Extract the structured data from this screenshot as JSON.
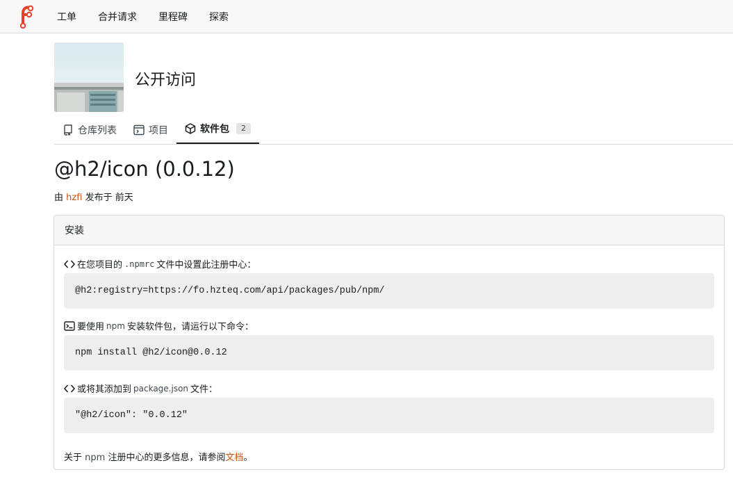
{
  "nav": {
    "items": [
      "工单",
      "合并请求",
      "里程碑",
      "探索"
    ]
  },
  "org": {
    "title": "公开访问"
  },
  "tabs": [
    {
      "label": "仓库列表",
      "icon": "repo-icon"
    },
    {
      "label": "项目",
      "icon": "project-icon"
    },
    {
      "label": "软件包",
      "icon": "package-icon",
      "count": "2",
      "active": true
    }
  ],
  "package": {
    "title": "@h2/icon (0.0.12)",
    "meta_prefix": "由",
    "author": "hzfi",
    "meta_middle": "发布于",
    "published": "前天"
  },
  "install": {
    "heading": "安装",
    "step1_prefix": "在您项目的",
    "step1_file": ".npmrc",
    "step1_suffix": "文件中设置此注册中心：",
    "step1_code": "@h2:registry=https://fo.hzteq.com/api/packages/pub/npm/",
    "step2_prefix": "要使用",
    "step2_tool": "npm",
    "step2_suffix": "安装软件包，请运行以下命令：",
    "step2_code": "npm install @h2/icon@0.0.12",
    "step3_prefix": "或将其添加到",
    "step3_file": "package.json",
    "step3_suffix": "文件：",
    "step3_code": "\"@h2/icon\": \"0.0.12\"",
    "footer_prefix": "关于",
    "footer_tool": "npm",
    "footer_middle": "注册中心的更多信息，请参阅",
    "footer_link": "文档",
    "footer_end": "。"
  },
  "colors": {
    "accent": "#c9500f",
    "logo": "#e8412b"
  }
}
